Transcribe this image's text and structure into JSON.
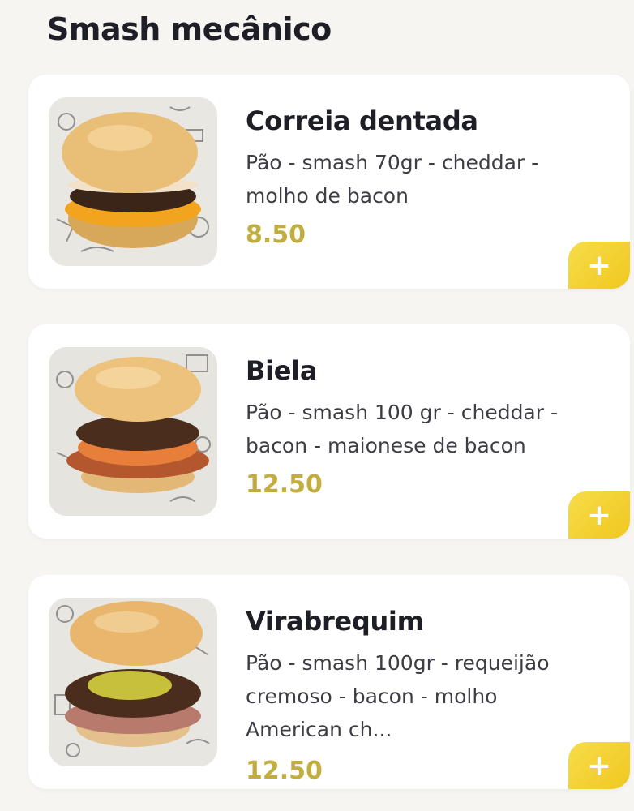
{
  "section": {
    "title": "Smash mecânico"
  },
  "items": [
    {
      "name": "Correia dentada",
      "description": "Pão - smash 70gr - cheddar - molho de bacon",
      "price": "8.50",
      "add_label": "+"
    },
    {
      "name": "Biela",
      "description": "Pão - smash 100 gr - cheddar - bacon - maionese de bacon",
      "price": "12.50",
      "add_label": "+"
    },
    {
      "name": "Virabrequim",
      "description": "Pão - smash 100gr - requeijão cremoso - bacon - molho American ch...",
      "price": "12.50",
      "add_label": "+"
    }
  ],
  "colors": {
    "price": "#c2ad3f",
    "add_button": "#f3cf2c",
    "background": "#f6f5f1"
  }
}
